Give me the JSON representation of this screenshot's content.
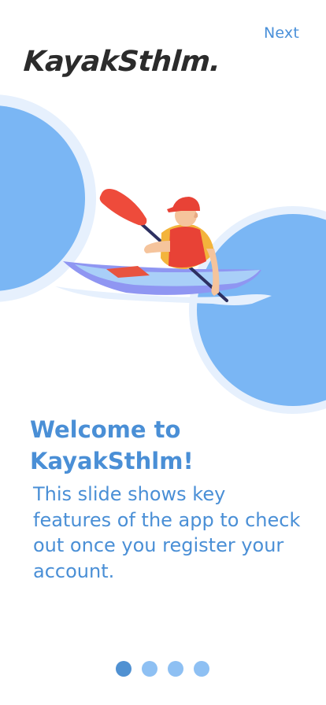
{
  "header": {
    "next_label": "Next",
    "logo_text": "KayakSthlm."
  },
  "hero": {
    "illustration": "kayaker-illustration"
  },
  "content": {
    "title": "Welcome to KayakSthlm!",
    "body": "This slide shows key features of the app to check out once you register your account."
  },
  "pagination": {
    "total": 4,
    "active_index": 0
  },
  "colors": {
    "accent": "#4a8fd6",
    "circle_light": "#e6f0fd",
    "circle_main": "#7ab6f4",
    "dot_active": "#5091d2",
    "dot_inactive": "#8ec0f3"
  }
}
